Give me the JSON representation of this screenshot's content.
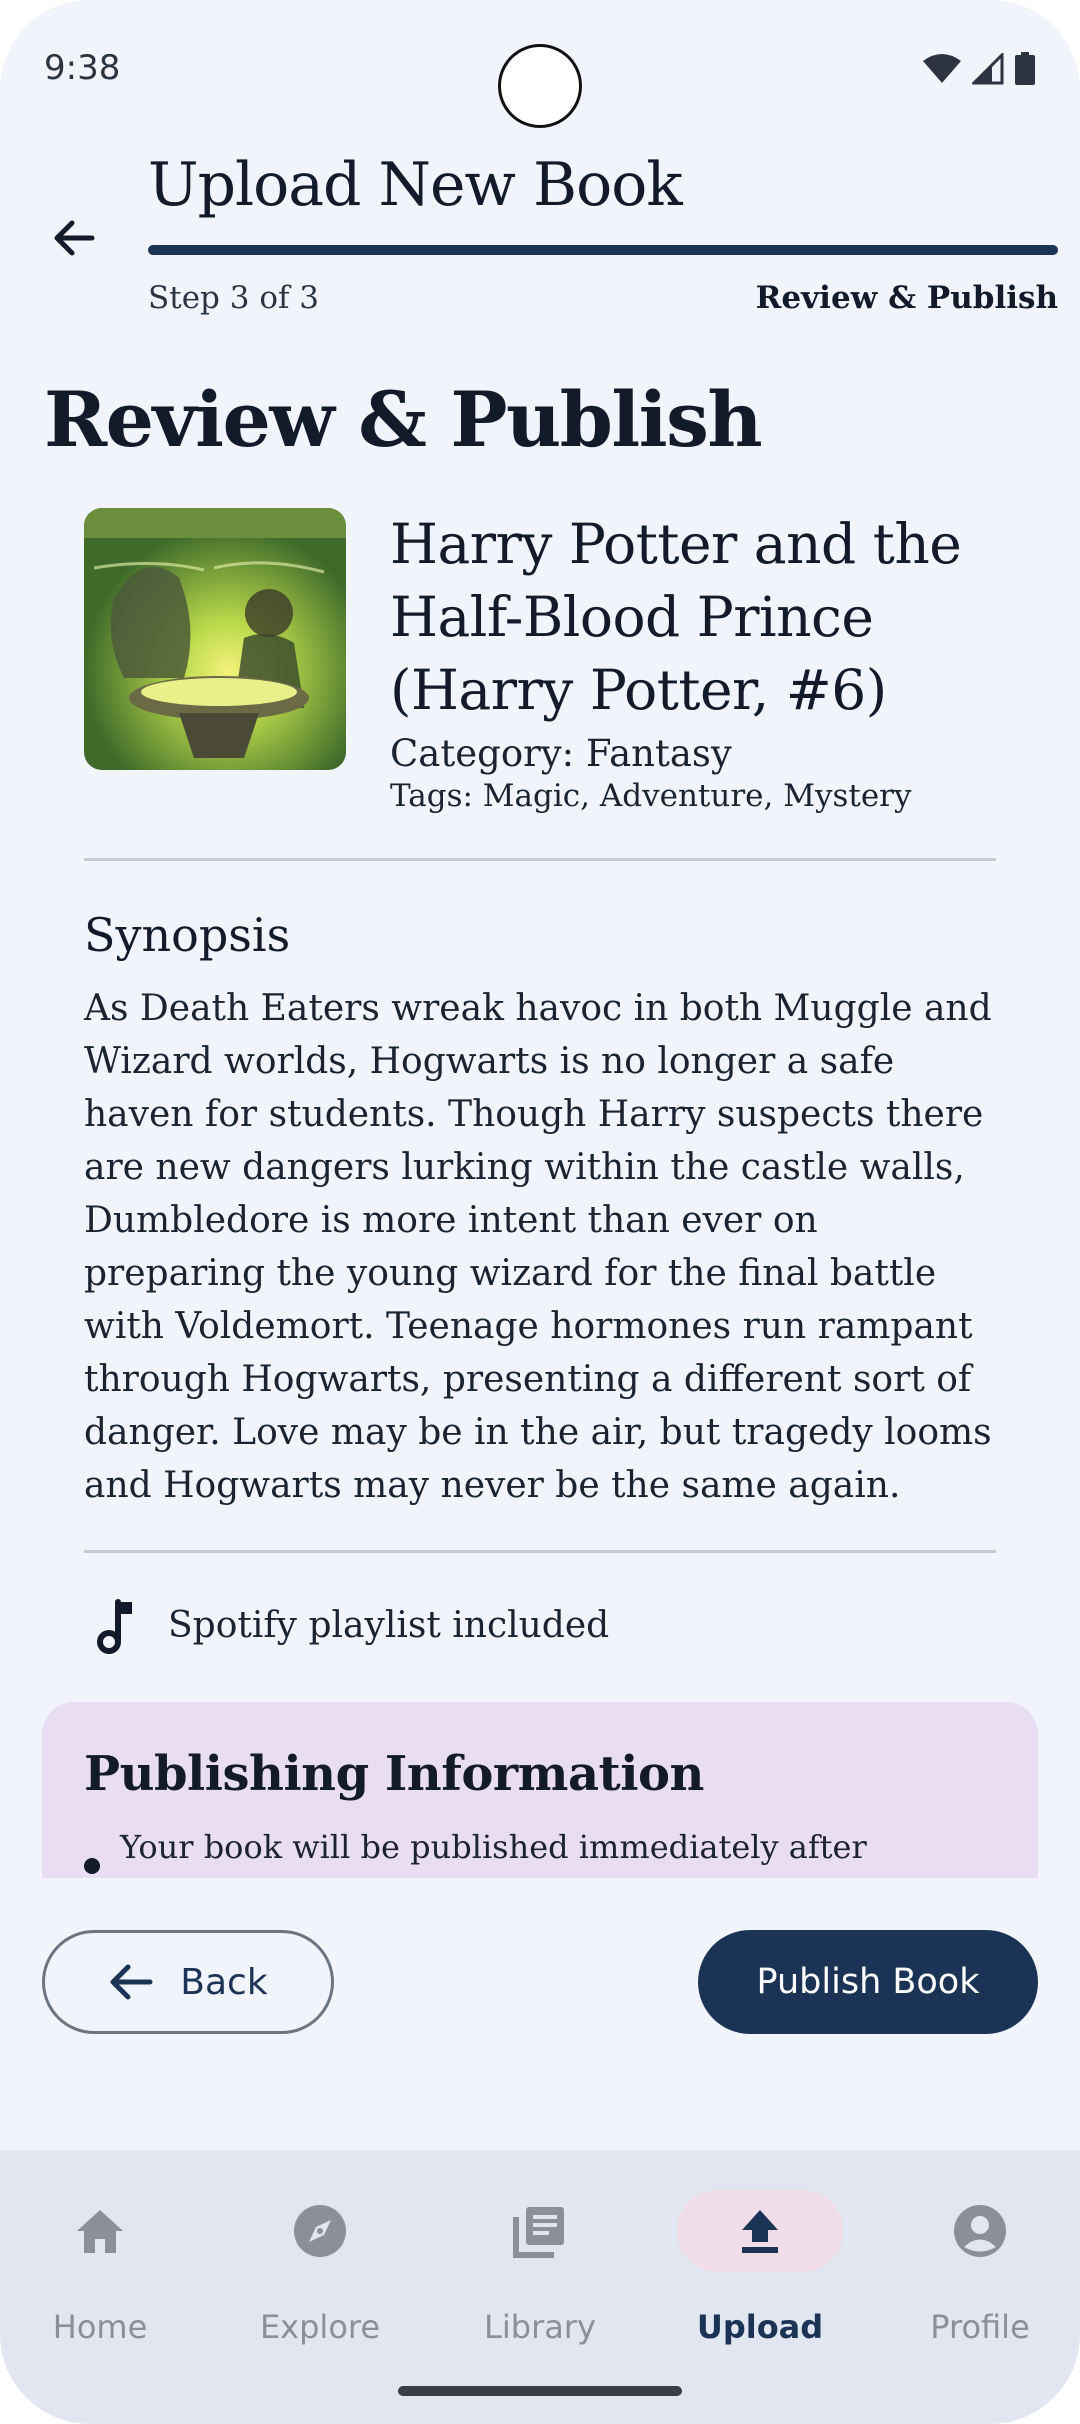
{
  "status_bar": {
    "time": "9:38"
  },
  "header": {
    "title": "Upload New Book",
    "step_text": "Step 3 of 3",
    "step_name": "Review & Publish",
    "progress": 1.0
  },
  "page_title": "Review & Publish",
  "book": {
    "title": "Harry Potter and the Half-Blood Prince (Harry Potter, #6)",
    "category": "Category: Fantasy",
    "tags": "Tags: Magic, Adventure, Mystery"
  },
  "synopsis": {
    "heading": "Synopsis",
    "text": "As Death Eaters wreak havoc in both Muggle and Wizard worlds, Hogwarts is no longer a safe haven for students. Though Harry suspects there are new dangers lurking within the castle walls, Dumbledore is more intent than ever on preparing the young wizard for the final battle with Voldemort. Teenage hormones run rampant through Hogwarts, presenting a different sort of danger. Love may be in the air, but tragedy looms and Hogwarts may never be the same again."
  },
  "playlist": {
    "label": "Spotify playlist included",
    "icon": "music-note-icon"
  },
  "publishing_info": {
    "heading": "Publishing Information",
    "bullets": [
      "Your book will be published immediately after"
    ]
  },
  "actions": {
    "back_label": "Back",
    "publish_label": "Publish Book"
  },
  "nav": {
    "items": [
      {
        "label": "Home",
        "icon": "home-icon"
      },
      {
        "label": "Explore",
        "icon": "compass-icon"
      },
      {
        "label": "Library",
        "icon": "library-icon"
      },
      {
        "label": "Upload",
        "icon": "upload-icon",
        "active": true
      },
      {
        "label": "Profile",
        "icon": "profile-icon"
      }
    ]
  },
  "colors": {
    "primary": "#1b3456",
    "background": "#f2f4fb",
    "publishing_card": "#e9ddf4",
    "nav_bar": "#e1e6f1",
    "nav_active_pill": "#f1dde7"
  }
}
